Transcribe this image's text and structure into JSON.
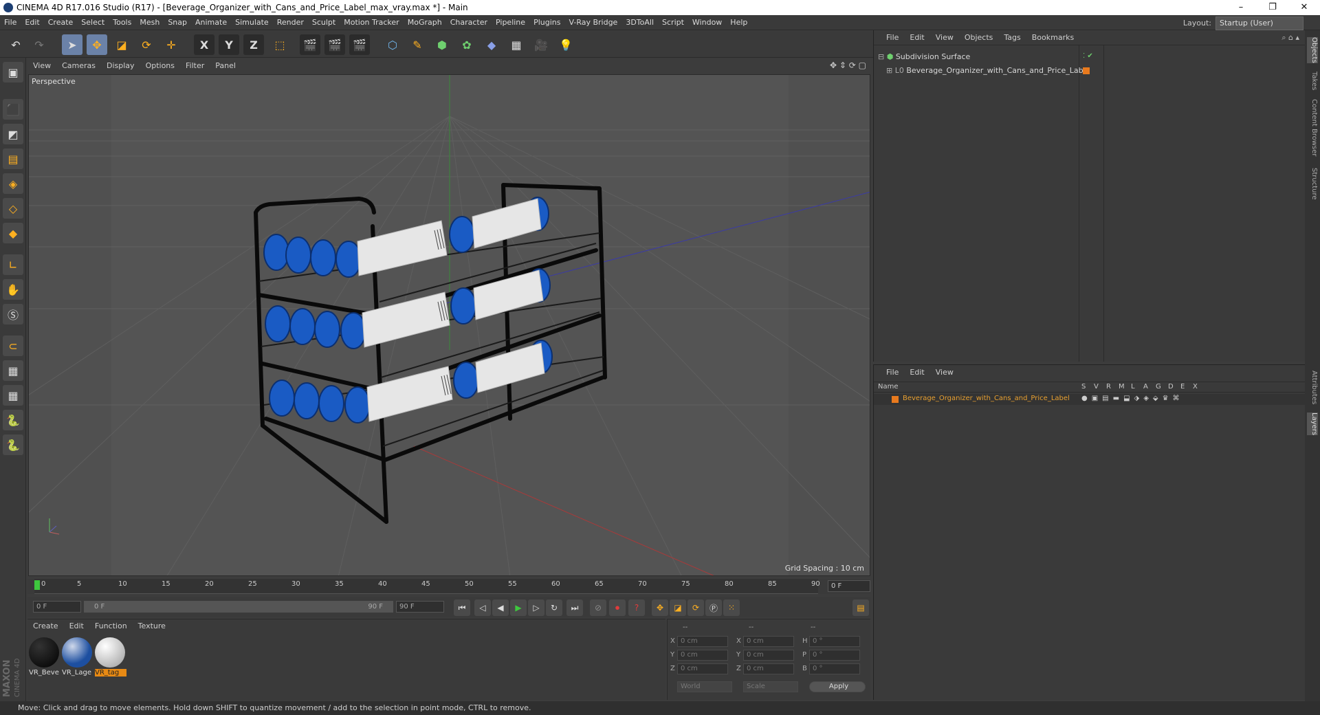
{
  "window": {
    "title": "CINEMA 4D R17.016 Studio (R17) - [Beverage_Organizer_with_Cans_and_Price_Label_max_vray.max *] - Main",
    "minimize": "–",
    "maximize": "❐",
    "close": "✕"
  },
  "menubar": {
    "items": [
      "File",
      "Edit",
      "Create",
      "Select",
      "Tools",
      "Mesh",
      "Snap",
      "Animate",
      "Simulate",
      "Render",
      "Sculpt",
      "Motion Tracker",
      "MoGraph",
      "Character",
      "Pipeline",
      "Plugins",
      "V-Ray Bridge",
      "3DToAll",
      "Script",
      "Window",
      "Help"
    ],
    "layout_label": "Layout:",
    "layout_value": "Startup (User)"
  },
  "toolbar": {
    "axis_x": "X",
    "axis_y": "Y",
    "axis_z": "Z"
  },
  "viewport": {
    "menu": [
      "View",
      "Cameras",
      "Display",
      "Options",
      "Filter",
      "Panel"
    ],
    "label": "Perspective",
    "grid_spacing": "Grid Spacing : 10 cm",
    "bg_color": "#505050",
    "grid_color": "#5e5e5e"
  },
  "timeline": {
    "ticks": [
      "0",
      "5",
      "10",
      "15",
      "20",
      "25",
      "30",
      "35",
      "40",
      "45",
      "50",
      "55",
      "60",
      "65",
      "70",
      "75",
      "80",
      "85",
      "90"
    ],
    "current_frame": "0 F"
  },
  "transport": {
    "start_frame": "0 F",
    "range_start": "0 F",
    "range_end": "90 F",
    "end_frame": "90 F"
  },
  "materials": {
    "menu": [
      "Create",
      "Edit",
      "Function",
      "Texture"
    ],
    "items": [
      {
        "label": "VR_Beve",
        "color": "#0a0a0a"
      },
      {
        "label": "VR_Lage",
        "color": "#1d4fa0"
      },
      {
        "label": "VR_tag",
        "color": "#e8e8e8"
      }
    ]
  },
  "coords": {
    "headers": [
      "--",
      "--",
      "--"
    ],
    "rows": [
      {
        "a": "X",
        "av": "0 cm",
        "b": "X",
        "bv": "0 cm",
        "c": "H",
        "cv": "0 °"
      },
      {
        "a": "Y",
        "av": "0 cm",
        "b": "Y",
        "bv": "0 cm",
        "c": "P",
        "cv": "0 °"
      },
      {
        "a": "Z",
        "av": "0 cm",
        "b": "Z",
        "bv": "0 cm",
        "c": "B",
        "cv": "0 °"
      }
    ],
    "world": "World",
    "scale": "Scale",
    "apply": "Apply"
  },
  "objects": {
    "menu": [
      "File",
      "Edit",
      "View",
      "Objects",
      "Tags",
      "Bookmarks"
    ],
    "items": [
      {
        "name": "Subdivision Surface"
      },
      {
        "name": "Beverage_Organizer_with_Cans_and_Price_Label"
      }
    ]
  },
  "layers": {
    "menu": [
      "File",
      "Edit",
      "View"
    ],
    "header_name": "Name",
    "columns": [
      "S",
      "V",
      "R",
      "M",
      "L",
      "A",
      "G",
      "D",
      "E",
      "X"
    ],
    "items": [
      {
        "name": "Beverage_Organizer_with_Cans_and_Price_Label",
        "color": "#e87a1e"
      }
    ]
  },
  "right_tabs": [
    "Objects",
    "Takes",
    "Content Browser",
    "Structure",
    "Attributes",
    "Layers"
  ],
  "status": "Move: Click and drag to move elements. Hold down SHIFT to quantize movement / add to the selection in point mode, CTRL to remove.",
  "brand": {
    "maxon": "MAXON",
    "cinema": "CINEMA 4D"
  }
}
